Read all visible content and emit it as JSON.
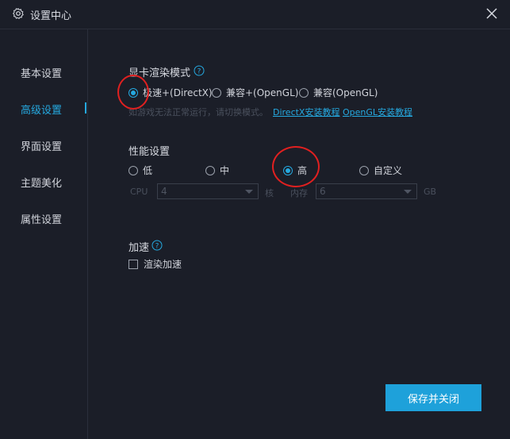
{
  "window": {
    "title": "设置中心",
    "title_icon": "gear-icon",
    "close_icon": "close-icon"
  },
  "sidebar": {
    "items": [
      {
        "label": "基本设置",
        "active": false
      },
      {
        "label": "高级设置",
        "active": true
      },
      {
        "label": "界面设置",
        "active": false
      },
      {
        "label": "主题美化",
        "active": false
      },
      {
        "label": "属性设置",
        "active": false
      }
    ]
  },
  "render_mode": {
    "title": "显卡渲染模式",
    "options": [
      {
        "label": "极速+(DirectX)",
        "checked": true
      },
      {
        "label": "兼容+(OpenGL)",
        "checked": false
      },
      {
        "label": "兼容(OpenGL)",
        "checked": false
      }
    ],
    "hint": "如游戏无法正常运行，请切换模式。",
    "link_directx": "DirectX安装教程",
    "link_opengl": "OpenGL安装教程"
  },
  "performance": {
    "title": "性能设置",
    "options": [
      {
        "label": "低",
        "checked": false
      },
      {
        "label": "中",
        "checked": false
      },
      {
        "label": "高",
        "checked": true
      },
      {
        "label": "自定义",
        "checked": false
      }
    ],
    "cpu_label": "CPU",
    "cpu_value": "4",
    "cpu_unit": "核",
    "mem_label": "内存",
    "mem_value": "6",
    "mem_unit": "GB"
  },
  "acceleration": {
    "title": "加速",
    "checkbox_label": "渲染加速",
    "checked": false
  },
  "save_button": "保存并关闭",
  "colors": {
    "accent": "#25a9e0",
    "background": "#1b1e28",
    "annotation": "#e02020"
  }
}
